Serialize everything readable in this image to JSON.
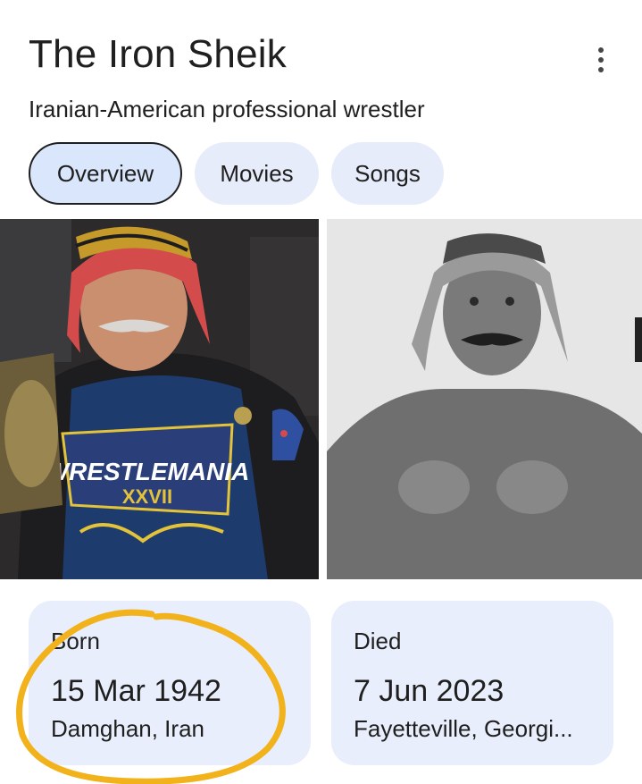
{
  "header": {
    "title": "The Iron Sheik",
    "subtitle": "Iranian-American professional wrestler"
  },
  "tabs": [
    {
      "label": "Overview",
      "active": true
    },
    {
      "label": "Movies",
      "active": false
    },
    {
      "label": "Songs",
      "active": false
    }
  ],
  "images": [
    {
      "name": "photo-sheik-wrestlemania-shirt"
    },
    {
      "name": "photo-sheik-black-and-white"
    }
  ],
  "facts": {
    "born": {
      "label": "Born",
      "date": "15 Mar 1942",
      "place": "Damghan, Iran"
    },
    "died": {
      "label": "Died",
      "date": "7 Jun 2023",
      "place": "Fayetteville, Georgi..."
    }
  },
  "colors": {
    "chip_bg": "#e6ecfa",
    "card_bg": "#e8eefb",
    "annotation": "#f2b21b"
  }
}
